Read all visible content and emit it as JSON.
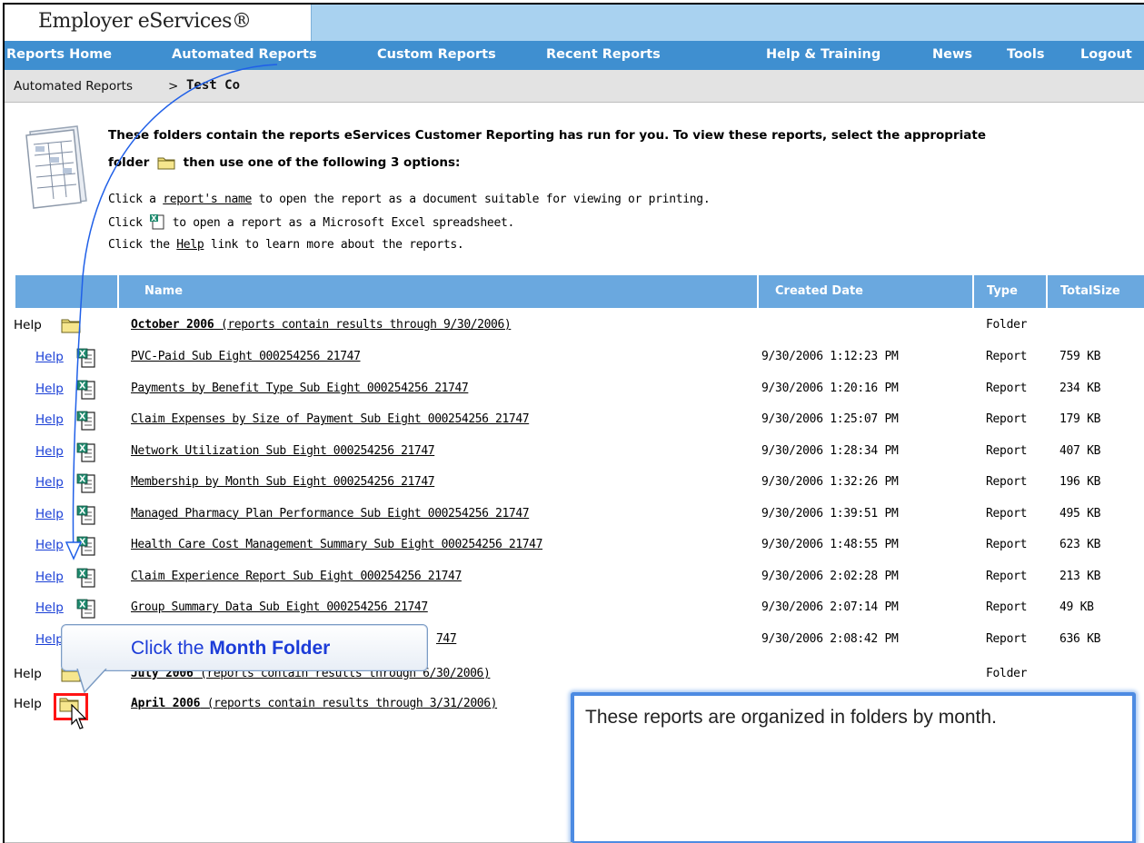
{
  "app": {
    "title": "Employer eServices®"
  },
  "nav": {
    "items": [
      "Reports Home",
      "Automated Reports",
      "Custom Reports",
      "Recent Reports",
      "Help & Training",
      "News",
      "Tools",
      "Logout"
    ]
  },
  "breadcrumb": {
    "parent": "Automated Reports",
    "separator": ">",
    "current": "Test Co"
  },
  "intro": {
    "title_line1": "These folders contain the reports eServices Customer Reporting has run for you. To view these reports, select the appropriate",
    "title_line2_pre": "folder",
    "title_line2_post": "then use one of the following 3 options:",
    "opt1_pre": "Click a ",
    "opt1_link": "report's name",
    "opt1_post": " to open the report as a document suitable for viewing or printing.",
    "opt2_pre": "Click ",
    "opt2_post": " to open a report as a Microsoft Excel spreadsheet.",
    "opt3_pre": "Click the ",
    "opt3_link": "Help",
    "opt3_post": " link to learn more about the reports."
  },
  "table": {
    "headers": {
      "name": "Name",
      "created": "Created Date",
      "type": "Type",
      "size": "TotalSize"
    },
    "help_label": "Help",
    "folders": [
      {
        "name_bold": "October 2006",
        "name_rest": " (reports contain results through 9/30/2006)",
        "type": "Folder"
      },
      {
        "name_bold": "July 2006",
        "name_rest": " (reports contain results through 6/30/2006)",
        "type": "Folder"
      },
      {
        "name_bold": "April 2006",
        "name_rest": " (reports contain results through 3/31/2006)",
        "type": ""
      }
    ],
    "reports": [
      {
        "name": "PVC-Paid Sub Eight 000254256 21747",
        "date": "9/30/2006 1:12:23 PM",
        "type": "Report",
        "size": "759 KB"
      },
      {
        "name": "Payments by Benefit Type Sub Eight 000254256 21747",
        "date": "9/30/2006 1:20:16 PM",
        "type": "Report",
        "size": "234 KB"
      },
      {
        "name": "Claim Expenses by Size of Payment Sub Eight 000254256 21747",
        "date": "9/30/2006 1:25:07 PM",
        "type": "Report",
        "size": "179 KB"
      },
      {
        "name": "Network Utilization Sub Eight 000254256 21747",
        "date": "9/30/2006 1:28:34 PM",
        "type": "Report",
        "size": "407 KB"
      },
      {
        "name": "Membership by Month Sub Eight 000254256 21747",
        "date": "9/30/2006 1:32:26 PM",
        "type": "Report",
        "size": "196 KB"
      },
      {
        "name": "Managed Pharmacy Plan Performance Sub Eight 000254256 21747",
        "date": "9/30/2006 1:39:51 PM",
        "type": "Report",
        "size": "495 KB"
      },
      {
        "name": "Health Care Cost Management Summary Sub Eight 000254256 21747",
        "date": "9/30/2006 1:48:55 PM",
        "type": "Report",
        "size": "623 KB"
      },
      {
        "name": "Claim Experience Report Sub Eight 000254256 21747",
        "date": "9/30/2006 2:02:28 PM",
        "type": "Report",
        "size": "213 KB"
      },
      {
        "name": "Group Summary Data Sub Eight 000254256 21747",
        "date": "9/30/2006 2:07:14 PM",
        "type": "Report",
        "size": "49 KB"
      },
      {
        "name": "747",
        "date": "9/30/2006 2:08:42 PM",
        "type": "Report",
        "size": "636 KB"
      }
    ]
  },
  "callouts": {
    "month_pre": "Click the ",
    "month_bold": "Month Folder",
    "info": "These reports are organized in folders by month."
  },
  "colors": {
    "nav_bg": "#3f8fd0",
    "header_bg": "#6aa8df",
    "brand_bar": "#a9d2f0",
    "callout_text": "#1c3cd8",
    "highlight": "#ff1414"
  }
}
